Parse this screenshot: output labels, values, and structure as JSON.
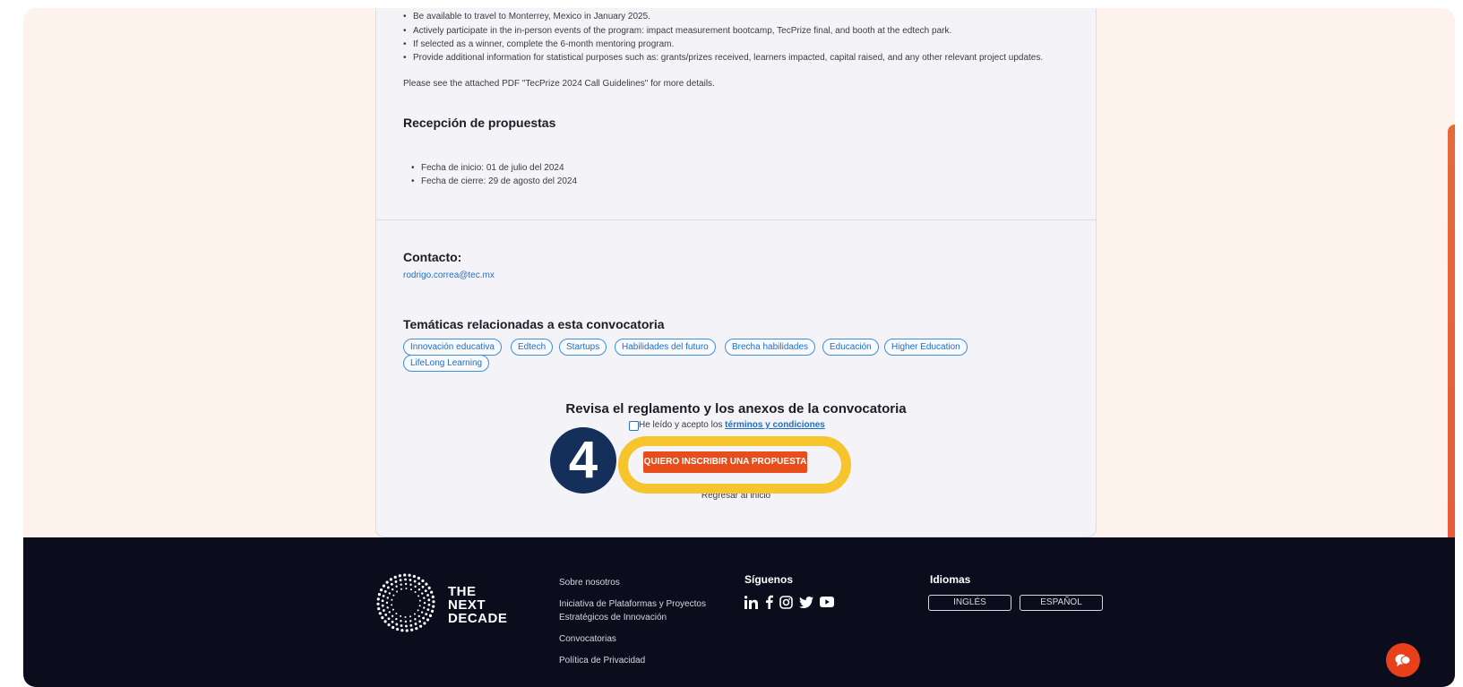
{
  "requirements": {
    "items": [
      "Be available to travel to Monterrey, Mexico in January 2025.",
      "Actively participate in the in-person events of the program: impact measurement bootcamp, TecPrize final, and booth at the edtech park.",
      "If selected as a winner, complete the 6-month mentoring program.",
      "Provide additional information for statistical purposes such as: grants/prizes received, learners impacted, capital raised, and any other relevant project updates."
    ],
    "note": "Please see the attached PDF \"TecPrize 2024 Call Guidelines\" for more details."
  },
  "reception": {
    "title": "Recepción de propuestas",
    "dates": [
      "Fecha de inicio: 01 de julio del 2024",
      "Fecha de cierre: 29 de agosto del 2024"
    ]
  },
  "contact": {
    "title": "Contacto:",
    "email": "rodrigo.correa@tec.mx"
  },
  "topics": {
    "title": "Temáticas relacionadas a esta convocatoria",
    "tags": [
      "Innovación educativa",
      "Edtech",
      "Startups",
      "Habilidades del futuro",
      "Brecha habilidades",
      "Educación",
      "Higher Education",
      "LifeLong Learning"
    ]
  },
  "rules": {
    "title": "Revisa el reglamento y los anexos de la convocatoria",
    "terms_prefix": "He leído y acepto los",
    "terms_link": "términos y condiciones",
    "cta_label": "QUIERO INSCRIBIR UNA PROPUESTA",
    "back_label": "Regresar al inicio"
  },
  "annotation": {
    "step": "4",
    "highlight_color": "#f6c42c",
    "circle_color": "#14305a"
  },
  "footer": {
    "logo_lines": [
      "THE",
      "NEXT",
      "DECADE"
    ],
    "links": [
      "Sobre nosotros",
      "Iniciativa de Plataformas y Proyectos",
      "Estratégicos de Innovación",
      "Convocatorias",
      "Política de Privacidad"
    ],
    "social_title": "Síguenos",
    "social_icons": [
      "linkedin-icon",
      "facebook-icon",
      "instagram-icon",
      "twitter-icon",
      "youtube-icon"
    ],
    "lang_title": "Idiomas",
    "lang_options": [
      "INGLÉS",
      "ESPAÑOL"
    ]
  },
  "colors": {
    "accent": "#e84e1b",
    "link": "#1f6fc7",
    "footer_bg": "#0b0d1d",
    "page_bg": "#fdf3ec"
  }
}
